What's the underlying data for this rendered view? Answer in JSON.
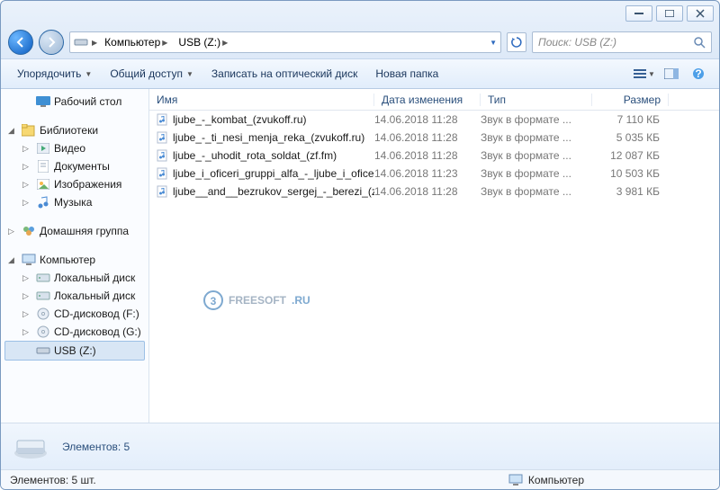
{
  "breadcrumb": {
    "seg1": "Компьютер",
    "seg2": "USB (Z:)"
  },
  "search": {
    "placeholder": "Поиск: USB (Z:)"
  },
  "toolbar": {
    "organize": "Упорядочить",
    "share": "Общий доступ",
    "burn": "Записать на оптический диск",
    "newfolder": "Новая папка"
  },
  "sidebar": {
    "desktop": "Рабочий стол",
    "libraries": "Библиотеки",
    "video": "Видео",
    "documents": "Документы",
    "pictures": "Изображения",
    "music": "Музыка",
    "homegroup": "Домашняя группа",
    "computer": "Компьютер",
    "local": "Локальный диск",
    "local2": "Локальный диск",
    "cdF": "CD-дисковод (F:)",
    "cdG": "CD-дисковод (G:)",
    "usb": "USB (Z:)"
  },
  "columns": {
    "name": "Имя",
    "modified": "Дата изменения",
    "type": "Тип",
    "size": "Размер"
  },
  "type_label": "Звук в формате ...",
  "files": [
    {
      "name": "ljube_-_kombat_(zvukoff.ru)",
      "date": "14.06.2018 11:28",
      "size": "7 110 КБ"
    },
    {
      "name": "ljube_-_ti_nesi_menja_reka_(zvukoff.ru)",
      "date": "14.06.2018 11:28",
      "size": "5 035 КБ"
    },
    {
      "name": "ljube_-_uhodit_rota_soldat_(zf.fm)",
      "date": "14.06.2018 11:28",
      "size": "12 087 КБ"
    },
    {
      "name": "ljube_i_oficeri_gruppi_alfa_-_ljube_i_ofice...",
      "date": "14.06.2018 11:23",
      "size": "10 503 КБ"
    },
    {
      "name": "ljube__and__bezrukov_sergej_-_berezi_(zv...",
      "date": "14.06.2018 11:28",
      "size": "3 981 КБ"
    }
  ],
  "details": {
    "label": "Элементов: 5"
  },
  "status": {
    "count": "Элементов: 5 шт.",
    "location": "Компьютер"
  },
  "watermark": {
    "brand": "FREESOFT",
    "tld": ".RU"
  }
}
